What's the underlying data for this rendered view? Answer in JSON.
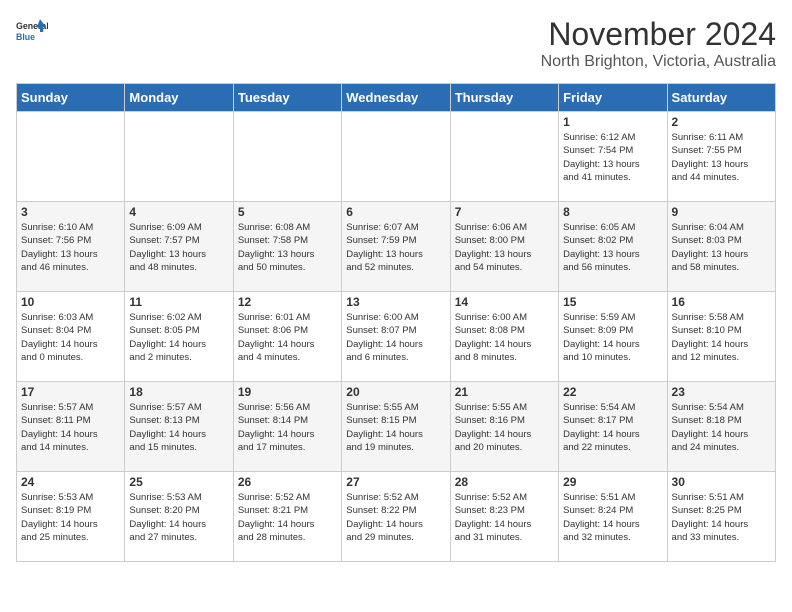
{
  "header": {
    "logo_line1": "General",
    "logo_line2": "Blue",
    "month": "November 2024",
    "location": "North Brighton, Victoria, Australia"
  },
  "days_of_week": [
    "Sunday",
    "Monday",
    "Tuesday",
    "Wednesday",
    "Thursday",
    "Friday",
    "Saturday"
  ],
  "weeks": [
    {
      "days": [
        {
          "num": "",
          "info": ""
        },
        {
          "num": "",
          "info": ""
        },
        {
          "num": "",
          "info": ""
        },
        {
          "num": "",
          "info": ""
        },
        {
          "num": "",
          "info": ""
        },
        {
          "num": "1",
          "info": "Sunrise: 6:12 AM\nSunset: 7:54 PM\nDaylight: 13 hours\nand 41 minutes."
        },
        {
          "num": "2",
          "info": "Sunrise: 6:11 AM\nSunset: 7:55 PM\nDaylight: 13 hours\nand 44 minutes."
        }
      ]
    },
    {
      "days": [
        {
          "num": "3",
          "info": "Sunrise: 6:10 AM\nSunset: 7:56 PM\nDaylight: 13 hours\nand 46 minutes."
        },
        {
          "num": "4",
          "info": "Sunrise: 6:09 AM\nSunset: 7:57 PM\nDaylight: 13 hours\nand 48 minutes."
        },
        {
          "num": "5",
          "info": "Sunrise: 6:08 AM\nSunset: 7:58 PM\nDaylight: 13 hours\nand 50 minutes."
        },
        {
          "num": "6",
          "info": "Sunrise: 6:07 AM\nSunset: 7:59 PM\nDaylight: 13 hours\nand 52 minutes."
        },
        {
          "num": "7",
          "info": "Sunrise: 6:06 AM\nSunset: 8:00 PM\nDaylight: 13 hours\nand 54 minutes."
        },
        {
          "num": "8",
          "info": "Sunrise: 6:05 AM\nSunset: 8:02 PM\nDaylight: 13 hours\nand 56 minutes."
        },
        {
          "num": "9",
          "info": "Sunrise: 6:04 AM\nSunset: 8:03 PM\nDaylight: 13 hours\nand 58 minutes."
        }
      ]
    },
    {
      "days": [
        {
          "num": "10",
          "info": "Sunrise: 6:03 AM\nSunset: 8:04 PM\nDaylight: 14 hours\nand 0 minutes."
        },
        {
          "num": "11",
          "info": "Sunrise: 6:02 AM\nSunset: 8:05 PM\nDaylight: 14 hours\nand 2 minutes."
        },
        {
          "num": "12",
          "info": "Sunrise: 6:01 AM\nSunset: 8:06 PM\nDaylight: 14 hours\nand 4 minutes."
        },
        {
          "num": "13",
          "info": "Sunrise: 6:00 AM\nSunset: 8:07 PM\nDaylight: 14 hours\nand 6 minutes."
        },
        {
          "num": "14",
          "info": "Sunrise: 6:00 AM\nSunset: 8:08 PM\nDaylight: 14 hours\nand 8 minutes."
        },
        {
          "num": "15",
          "info": "Sunrise: 5:59 AM\nSunset: 8:09 PM\nDaylight: 14 hours\nand 10 minutes."
        },
        {
          "num": "16",
          "info": "Sunrise: 5:58 AM\nSunset: 8:10 PM\nDaylight: 14 hours\nand 12 minutes."
        }
      ]
    },
    {
      "days": [
        {
          "num": "17",
          "info": "Sunrise: 5:57 AM\nSunset: 8:11 PM\nDaylight: 14 hours\nand 14 minutes."
        },
        {
          "num": "18",
          "info": "Sunrise: 5:57 AM\nSunset: 8:13 PM\nDaylight: 14 hours\nand 15 minutes."
        },
        {
          "num": "19",
          "info": "Sunrise: 5:56 AM\nSunset: 8:14 PM\nDaylight: 14 hours\nand 17 minutes."
        },
        {
          "num": "20",
          "info": "Sunrise: 5:55 AM\nSunset: 8:15 PM\nDaylight: 14 hours\nand 19 minutes."
        },
        {
          "num": "21",
          "info": "Sunrise: 5:55 AM\nSunset: 8:16 PM\nDaylight: 14 hours\nand 20 minutes."
        },
        {
          "num": "22",
          "info": "Sunrise: 5:54 AM\nSunset: 8:17 PM\nDaylight: 14 hours\nand 22 minutes."
        },
        {
          "num": "23",
          "info": "Sunrise: 5:54 AM\nSunset: 8:18 PM\nDaylight: 14 hours\nand 24 minutes."
        }
      ]
    },
    {
      "days": [
        {
          "num": "24",
          "info": "Sunrise: 5:53 AM\nSunset: 8:19 PM\nDaylight: 14 hours\nand 25 minutes."
        },
        {
          "num": "25",
          "info": "Sunrise: 5:53 AM\nSunset: 8:20 PM\nDaylight: 14 hours\nand 27 minutes."
        },
        {
          "num": "26",
          "info": "Sunrise: 5:52 AM\nSunset: 8:21 PM\nDaylight: 14 hours\nand 28 minutes."
        },
        {
          "num": "27",
          "info": "Sunrise: 5:52 AM\nSunset: 8:22 PM\nDaylight: 14 hours\nand 29 minutes."
        },
        {
          "num": "28",
          "info": "Sunrise: 5:52 AM\nSunset: 8:23 PM\nDaylight: 14 hours\nand 31 minutes."
        },
        {
          "num": "29",
          "info": "Sunrise: 5:51 AM\nSunset: 8:24 PM\nDaylight: 14 hours\nand 32 minutes."
        },
        {
          "num": "30",
          "info": "Sunrise: 5:51 AM\nSunset: 8:25 PM\nDaylight: 14 hours\nand 33 minutes."
        }
      ]
    }
  ]
}
